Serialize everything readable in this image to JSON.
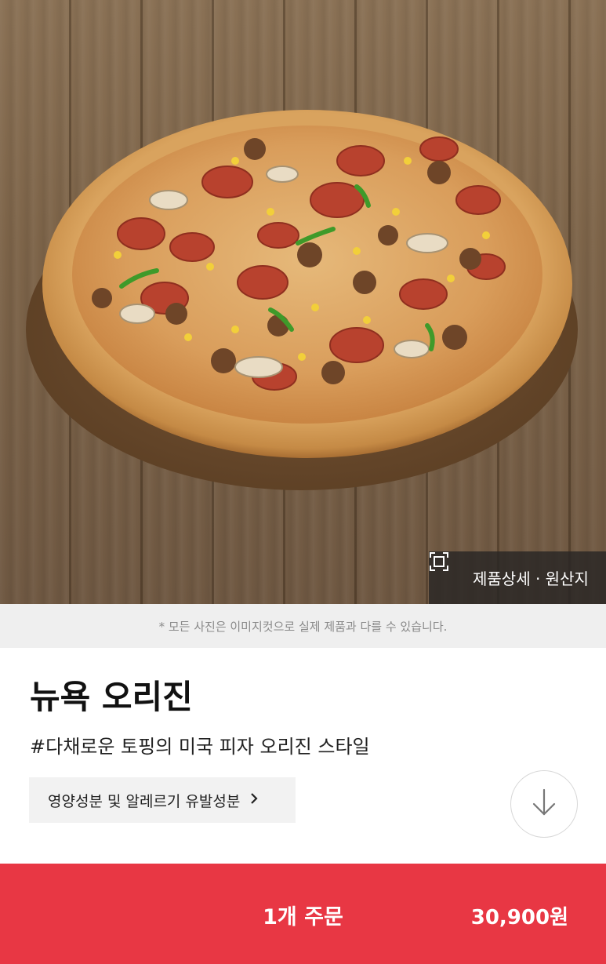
{
  "hero": {
    "image_subject": "pizza-photo",
    "detail_button_label": "제품상세 · 원산지"
  },
  "notice": "* 모든 사진은 이미지컷으로 실제 제품과 다를 수 있습니다.",
  "product": {
    "name": "뉴욕 오리진",
    "tagline": "#다채로운 토핑의 미국 피자 오리진 스타일",
    "nutrition_button_label": "영양성분 및 알레르기 유발성분"
  },
  "order": {
    "quantity_label": "1개 주문",
    "price": "30,900원"
  },
  "colors": {
    "accent": "#e83744",
    "notice_bg": "#efefef"
  }
}
